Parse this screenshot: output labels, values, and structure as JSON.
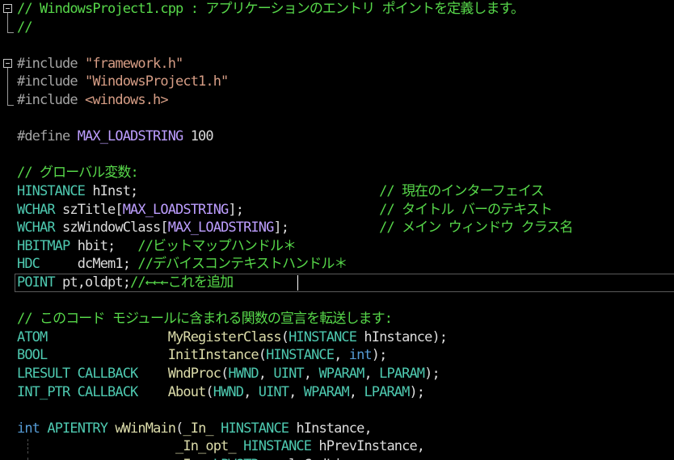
{
  "editor": {
    "lines": [
      {
        "id": "l1",
        "fold": "box",
        "guide": false,
        "current": false,
        "tokens": [
          {
            "t": "// WindowsProject1.cpp : アプリケーションのエントリ ポイントを定義します。",
            "c": "comment"
          }
        ]
      },
      {
        "id": "l2",
        "fold": "end",
        "guide": false,
        "current": false,
        "tokens": [
          {
            "t": "//",
            "c": "comment"
          }
        ]
      },
      {
        "id": "l3",
        "fold": "none",
        "guide": false,
        "current": false,
        "tokens": []
      },
      {
        "id": "l4",
        "fold": "box",
        "guide": false,
        "current": false,
        "tokens": [
          {
            "t": "#include ",
            "c": "pre"
          },
          {
            "t": "\"framework.h\"",
            "c": "str"
          }
        ]
      },
      {
        "id": "l5",
        "fold": "line",
        "guide": false,
        "current": false,
        "tokens": [
          {
            "t": "#include ",
            "c": "pre"
          },
          {
            "t": "\"WindowsProject1.h\"",
            "c": "str"
          }
        ]
      },
      {
        "id": "l6",
        "fold": "end",
        "guide": false,
        "current": false,
        "tokens": [
          {
            "t": "#include ",
            "c": "pre"
          },
          {
            "t": "<windows.h>",
            "c": "str"
          }
        ]
      },
      {
        "id": "l7",
        "fold": "none",
        "guide": false,
        "current": false,
        "tokens": []
      },
      {
        "id": "l8",
        "fold": "none",
        "guide": false,
        "current": false,
        "tokens": [
          {
            "t": "#define ",
            "c": "pre"
          },
          {
            "t": "MAX_LOADSTRING",
            "c": "macro"
          },
          {
            "t": " 100",
            "c": "plain"
          }
        ]
      },
      {
        "id": "l9",
        "fold": "none",
        "guide": false,
        "current": false,
        "tokens": []
      },
      {
        "id": "l10",
        "fold": "none",
        "guide": false,
        "current": false,
        "tokens": [
          {
            "t": "// グローバル変数:",
            "c": "comment"
          }
        ]
      },
      {
        "id": "l11",
        "fold": "none",
        "guide": false,
        "current": false,
        "tokens": [
          {
            "t": "HINSTANCE",
            "c": "type"
          },
          {
            "t": " hInst;                                ",
            "c": "plain"
          },
          {
            "t": "// 現在のインターフェイス",
            "c": "comment"
          }
        ]
      },
      {
        "id": "l12",
        "fold": "none",
        "guide": false,
        "current": false,
        "tokens": [
          {
            "t": "WCHAR",
            "c": "type"
          },
          {
            "t": " szTitle[",
            "c": "plain"
          },
          {
            "t": "MAX_LOADSTRING",
            "c": "macro"
          },
          {
            "t": "];                  ",
            "c": "plain"
          },
          {
            "t": "// タイトル バーのテキスト",
            "c": "comment"
          }
        ]
      },
      {
        "id": "l13",
        "fold": "none",
        "guide": false,
        "current": false,
        "tokens": [
          {
            "t": "WCHAR",
            "c": "type"
          },
          {
            "t": " szWindowClass[",
            "c": "plain"
          },
          {
            "t": "MAX_LOADSTRING",
            "c": "macro"
          },
          {
            "t": "];            ",
            "c": "plain"
          },
          {
            "t": "// メイン ウィンドウ クラス名",
            "c": "comment"
          }
        ]
      },
      {
        "id": "l14",
        "fold": "none",
        "guide": false,
        "current": false,
        "tokens": [
          {
            "t": "HBITMAP",
            "c": "type"
          },
          {
            "t": " hbit;   ",
            "c": "plain"
          },
          {
            "t": "//ビットマップハンドル＊",
            "c": "comment"
          }
        ]
      },
      {
        "id": "l15",
        "fold": "none",
        "guide": false,
        "current": false,
        "tokens": [
          {
            "t": "HDC",
            "c": "type"
          },
          {
            "t": "     dcMem1; ",
            "c": "plain"
          },
          {
            "t": "//デバイスコンテキストハンドル＊",
            "c": "comment"
          }
        ]
      },
      {
        "id": "l16",
        "fold": "none",
        "guide": false,
        "current": true,
        "tokens": [
          {
            "t": "POINT",
            "c": "type"
          },
          {
            "t": " pt,oldpt;",
            "c": "plain"
          },
          {
            "t": "//←←←これを追加",
            "c": "comment"
          }
        ]
      },
      {
        "id": "l17",
        "fold": "none",
        "guide": false,
        "current": false,
        "tokens": []
      },
      {
        "id": "l18",
        "fold": "none",
        "guide": false,
        "current": false,
        "tokens": [
          {
            "t": "// このコード モジュールに含まれる関数の宣言を転送します:",
            "c": "comment"
          }
        ]
      },
      {
        "id": "l19",
        "fold": "none",
        "guide": false,
        "current": false,
        "tokens": [
          {
            "t": "ATOM",
            "c": "type"
          },
          {
            "t": "                ",
            "c": "plain"
          },
          {
            "t": "MyRegisterClass",
            "c": "func"
          },
          {
            "t": "(",
            "c": "plain"
          },
          {
            "t": "HINSTANCE",
            "c": "type"
          },
          {
            "t": " hInstance);",
            "c": "plain"
          }
        ]
      },
      {
        "id": "l20",
        "fold": "none",
        "guide": false,
        "current": false,
        "tokens": [
          {
            "t": "BOOL",
            "c": "type"
          },
          {
            "t": "                ",
            "c": "plain"
          },
          {
            "t": "InitInstance",
            "c": "func"
          },
          {
            "t": "(",
            "c": "plain"
          },
          {
            "t": "HINSTANCE",
            "c": "type"
          },
          {
            "t": ", ",
            "c": "plain"
          },
          {
            "t": "int",
            "c": "kw"
          },
          {
            "t": ");",
            "c": "plain"
          }
        ]
      },
      {
        "id": "l21",
        "fold": "none",
        "guide": false,
        "current": false,
        "tokens": [
          {
            "t": "LRESULT CALLBACK",
            "c": "type"
          },
          {
            "t": "    ",
            "c": "plain"
          },
          {
            "t": "WndProc",
            "c": "func"
          },
          {
            "t": "(",
            "c": "plain"
          },
          {
            "t": "HWND",
            "c": "type"
          },
          {
            "t": ", ",
            "c": "plain"
          },
          {
            "t": "UINT",
            "c": "type"
          },
          {
            "t": ", ",
            "c": "plain"
          },
          {
            "t": "WPARAM",
            "c": "type"
          },
          {
            "t": ", ",
            "c": "plain"
          },
          {
            "t": "LPARAM",
            "c": "type"
          },
          {
            "t": ");",
            "c": "plain"
          }
        ]
      },
      {
        "id": "l22",
        "fold": "none",
        "guide": false,
        "current": false,
        "tokens": [
          {
            "t": "INT_PTR CALLBACK",
            "c": "type"
          },
          {
            "t": "    ",
            "c": "plain"
          },
          {
            "t": "About",
            "c": "func"
          },
          {
            "t": "(",
            "c": "plain"
          },
          {
            "t": "HWND",
            "c": "type"
          },
          {
            "t": ", ",
            "c": "plain"
          },
          {
            "t": "UINT",
            "c": "type"
          },
          {
            "t": ", ",
            "c": "plain"
          },
          {
            "t": "WPARAM",
            "c": "type"
          },
          {
            "t": ", ",
            "c": "plain"
          },
          {
            "t": "LPARAM",
            "c": "type"
          },
          {
            "t": ");",
            "c": "plain"
          }
        ]
      },
      {
        "id": "l23",
        "fold": "none",
        "guide": false,
        "current": false,
        "tokens": []
      },
      {
        "id": "l24",
        "fold": "none",
        "guide": false,
        "current": false,
        "tokens": [
          {
            "t": "int",
            "c": "kw"
          },
          {
            "t": " ",
            "c": "plain"
          },
          {
            "t": "APIENTRY",
            "c": "type"
          },
          {
            "t": " ",
            "c": "plain"
          },
          {
            "t": "wWinMain",
            "c": "func"
          },
          {
            "t": "(",
            "c": "plain"
          },
          {
            "t": "_In_",
            "c": "func"
          },
          {
            "t": " ",
            "c": "plain"
          },
          {
            "t": "HINSTANCE",
            "c": "type"
          },
          {
            "t": " hInstance,",
            "c": "plain"
          }
        ]
      },
      {
        "id": "l25",
        "fold": "none",
        "guide": true,
        "current": false,
        "tokens": [
          {
            "t": "                     ",
            "c": "plain"
          },
          {
            "t": "_In_opt_",
            "c": "func"
          },
          {
            "t": " ",
            "c": "plain"
          },
          {
            "t": "HINSTANCE",
            "c": "type"
          },
          {
            "t": " hPrevInstance,",
            "c": "plain"
          }
        ]
      },
      {
        "id": "l26",
        "fold": "none",
        "guide": true,
        "current": false,
        "tokens": [
          {
            "t": "                     ",
            "c": "plain"
          },
          {
            "t": "_In_",
            "c": "func"
          },
          {
            "t": " ",
            "c": "plain"
          },
          {
            "t": "LPWSTR",
            "c": "type"
          },
          {
            "t": "    lpCmdLine,",
            "c": "plain"
          }
        ]
      }
    ]
  }
}
